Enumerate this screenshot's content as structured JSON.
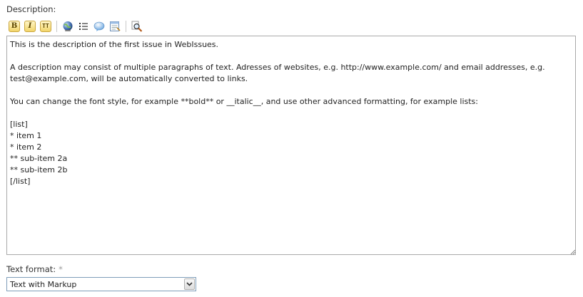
{
  "description_label": "Description:",
  "toolbar": {
    "bold_letter": "B",
    "italic_letter": "I",
    "monospace_letter": "TT",
    "icons": [
      "bold-icon",
      "italic-icon",
      "monospace-icon",
      "link-icon",
      "list-icon",
      "quote-icon",
      "code-icon",
      "preview-icon"
    ]
  },
  "editor": {
    "value": "This is the description of the first issue in WebIssues.\n\nA description may consist of multiple paragraphs of text. Adresses of websites, e.g. http://www.example.com/ and email addresses, e.g.\ntest@example.com, will be automatically converted to links.\n\nYou can change the font style, for example **bold** or __italic__, and use other advanced formatting, for example lists:\n\n[list]\n* item 1\n* item 2\n** sub-item 2a\n** sub-item 2b\n[/list]"
  },
  "text_format": {
    "label": "Text format:",
    "required_mark": "*",
    "selected": "Text with Markup"
  },
  "colors": {
    "border": "#a9a9a9",
    "select_border": "#7f9db9",
    "button_gold": "#f2d56a"
  }
}
